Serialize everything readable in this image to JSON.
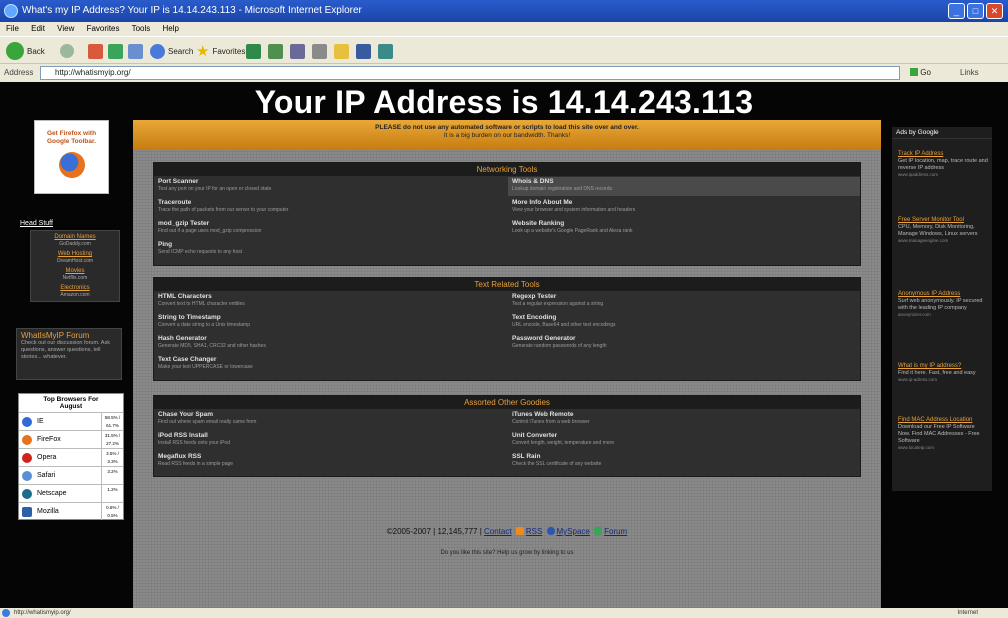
{
  "browser": {
    "title": "What's my IP Address? Your IP is 14.14.243.113 - Microsoft Internet Explorer",
    "menu": [
      "File",
      "Edit",
      "View",
      "Favorites",
      "Tools",
      "Help"
    ],
    "toolbar": {
      "back": "Back",
      "search": "Search",
      "favorites": "Favorites"
    },
    "address_label": "Address",
    "url": "http://whatismyip.org/",
    "go_label": "Go",
    "links_label": "Links",
    "status_url": "http://whatismyip.org/",
    "status_zone": "Internet"
  },
  "page": {
    "headline": "Your IP Address is 14.14.243.113",
    "notice_line1": "PLEASE do not use any automated software or scripts to load this site over and over.",
    "notice_line2": "It is a big burden on our bandwidth. Thanks!",
    "sections": [
      {
        "title": "Networking Tools",
        "items": [
          {
            "title": "Port Scanner",
            "desc": "Test any port on your IP for an open or closed state"
          },
          {
            "title": "Traceroute",
            "desc": "Trace the path of packets from our server to your computer"
          },
          {
            "title": "mod_gzip Tester",
            "desc": "Find out if a page uses mod_gzip compression"
          },
          {
            "title": "Ping",
            "desc": "Send ICMP echo requests to any host"
          },
          {
            "title": "Whois & DNS",
            "desc": "Lookup domain registration and DNS records"
          },
          {
            "title": "More Info About Me",
            "desc": "View your browser and system information and headers"
          },
          {
            "title": "Website Ranking",
            "desc": "Look up a website's Google PageRank and Alexa rank"
          }
        ]
      },
      {
        "title": "Text Related Tools",
        "items": [
          {
            "title": "HTML Characters",
            "desc": "Convert text to HTML character entities"
          },
          {
            "title": "String to Timestamp",
            "desc": "Convert a date string to a Unix timestamp"
          },
          {
            "title": "Hash Generator",
            "desc": "Generate MD5, SHA1, CRC32 and other hashes"
          },
          {
            "title": "Text Case Changer",
            "desc": "Make your text UPPERCASE or lowercase"
          },
          {
            "title": "Regexp Tester",
            "desc": "Test a regular expression against a string"
          },
          {
            "title": "Text Encoding",
            "desc": "URL encode, Base64 and other text encodings"
          },
          {
            "title": "Password Generator",
            "desc": "Generate random passwords of any length"
          }
        ]
      },
      {
        "title": "Assorted Other Goodies",
        "items": [
          {
            "title": "Chase Your Spam",
            "desc": "Find out where spam email really came from"
          },
          {
            "title": "iPod RSS Install",
            "desc": "Install RSS feeds onto your iPod"
          },
          {
            "title": "Megaflux RSS",
            "desc": "Read RSS feeds in a simple page"
          },
          {
            "title": "iTunes Web Remote",
            "desc": "Control iTunes from a web browser"
          },
          {
            "title": "Unit Converter",
            "desc": "Convert length, weight, temperature and more"
          },
          {
            "title": "SSL Rain",
            "desc": "Check the SSL certificate of any website"
          }
        ]
      }
    ],
    "footer": {
      "copyright": "©2005-2007 | 12,145,777 |",
      "contact": "Contact",
      "rss": "RSS",
      "myspace": "MySpace",
      "forum": "Forum",
      "note": "Do you like this site? Help us grow by linking to us"
    }
  },
  "left": {
    "firefox_line1": "Get Firefox with",
    "firefox_line2": "Google Toolbar.",
    "head_stuff": "Head Stuff",
    "links": [
      {
        "name": "Domain Names",
        "url": "GoDaddy.com"
      },
      {
        "name": "Web Hosting",
        "url": "DreamHost.com"
      },
      {
        "name": "Movies",
        "url": "Netflix.com"
      },
      {
        "name": "Electronics",
        "url": "Amazon.com"
      }
    ],
    "forum_title": "WhatIsMyIP Forum",
    "forum_desc": "Check out our discussion forum. Ask questions, answer questions, tell stories... whatever.",
    "browsers_title_line1": "Top Browsers For",
    "browsers_title_line2": "August",
    "browsers": [
      {
        "name": "IE",
        "pct": "58.5% / 61.7%",
        "color": "#2f6ad8"
      },
      {
        "name": "FireFox",
        "pct": "31.5% / 27.2%",
        "color": "#e8711c"
      },
      {
        "name": "Opera",
        "pct": "3.5% / 3.3%",
        "color": "#d0241b"
      },
      {
        "name": "Safari",
        "pct": "3.2%",
        "color": "#5a8fd6"
      },
      {
        "name": "Netscape",
        "pct": "1.2%",
        "color": "#1b6b8a"
      },
      {
        "name": "Mozilla",
        "pct": "0.6% / 0.5%",
        "color": "#2b5faa"
      }
    ]
  },
  "right": {
    "header": "Ads by Google",
    "ads": [
      {
        "title": "Track IP Address",
        "desc": "Get IP location, map, trace route and reverse IP address",
        "url": "www.ipaddress.com"
      },
      {
        "title": "Free Server Monitor Tool",
        "desc": "CPU, Memory, Disk Monitoring, Manage Windows, Linux servers",
        "url": "www.manageengine.com"
      },
      {
        "title": "Anonymous IP Address",
        "desc": "Surf web anonymously. IP secured with the leading IP company",
        "url": "anonymizer.com"
      },
      {
        "title": "What is my IP address?",
        "desc": "Find it here. Fast, free and easy",
        "url": "www.ip-adress.com"
      },
      {
        "title": "Find MAC Address Location",
        "desc": "Download our Free IP Software Now. Find MAC Addresses - Free Software",
        "url": "www.locateip.com"
      }
    ]
  }
}
